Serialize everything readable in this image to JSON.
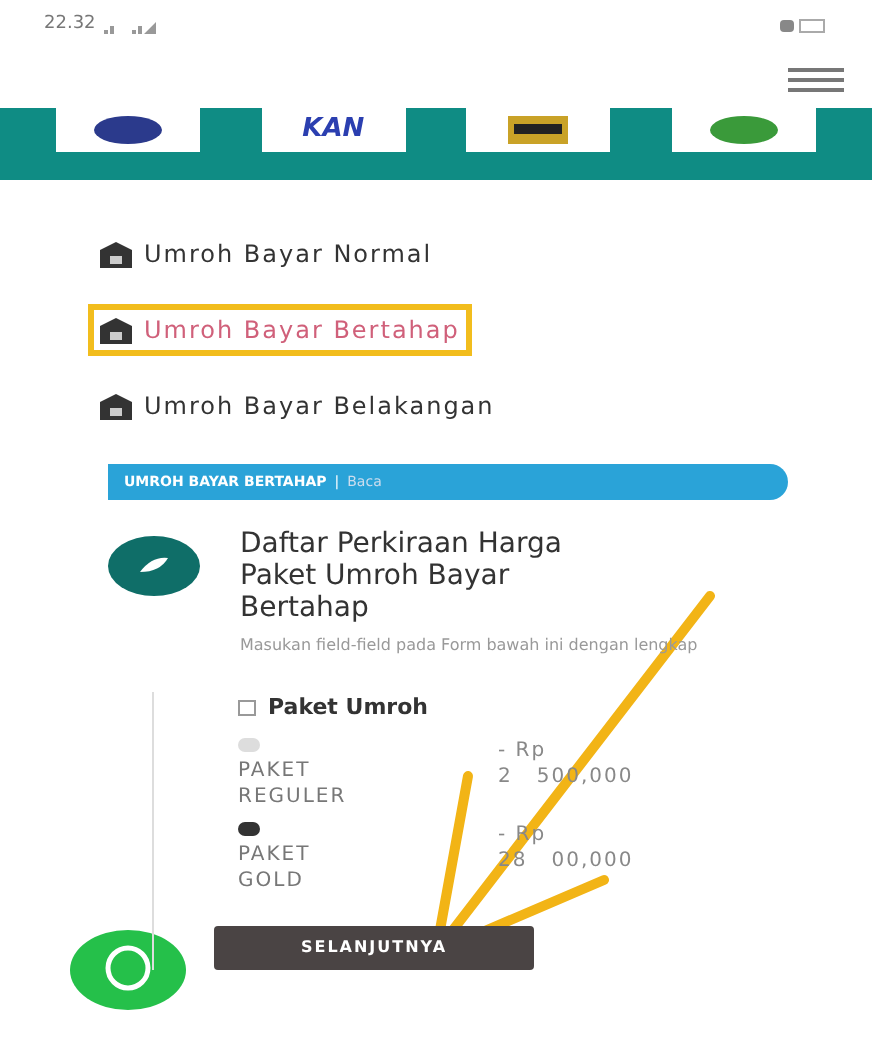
{
  "status_bar": {
    "time": "22.32"
  },
  "partner_logos": [
    {
      "kind": "emblem",
      "color": "#2b3a8c"
    },
    {
      "kind": "wordmark",
      "label": "KAN"
    },
    {
      "kind": "badge",
      "color": "#c9a227"
    },
    {
      "kind": "emblem",
      "color": "#3a9a3a"
    }
  ],
  "menu": [
    {
      "label": "Umroh Bayar Normal",
      "selected": false
    },
    {
      "label": "Umroh Bayar Bertahap",
      "selected": true
    },
    {
      "label": "Umroh Bayar Belakangan",
      "selected": false
    }
  ],
  "banner": {
    "title": "UMROH BAYAR BERTAHAP",
    "separator": "|",
    "link": "Baca"
  },
  "form": {
    "title": "Daftar Perkiraan Harga Paket Umroh Bayar Bertahap",
    "subtitle": "Masukan field-field pada Form bawah ini dengan lengkap",
    "group_label": "Paket Umroh",
    "options": [
      {
        "label": "PAKET REGULER",
        "price_prefix": "- Rp",
        "price_parts": [
          "2",
          "500,000"
        ],
        "selected": false
      },
      {
        "label": "PAKET GOLD",
        "price_prefix": "- Rp",
        "price_parts": [
          "28",
          "00,000"
        ],
        "selected": true
      }
    ],
    "submit": "SELANJUTNYA"
  }
}
